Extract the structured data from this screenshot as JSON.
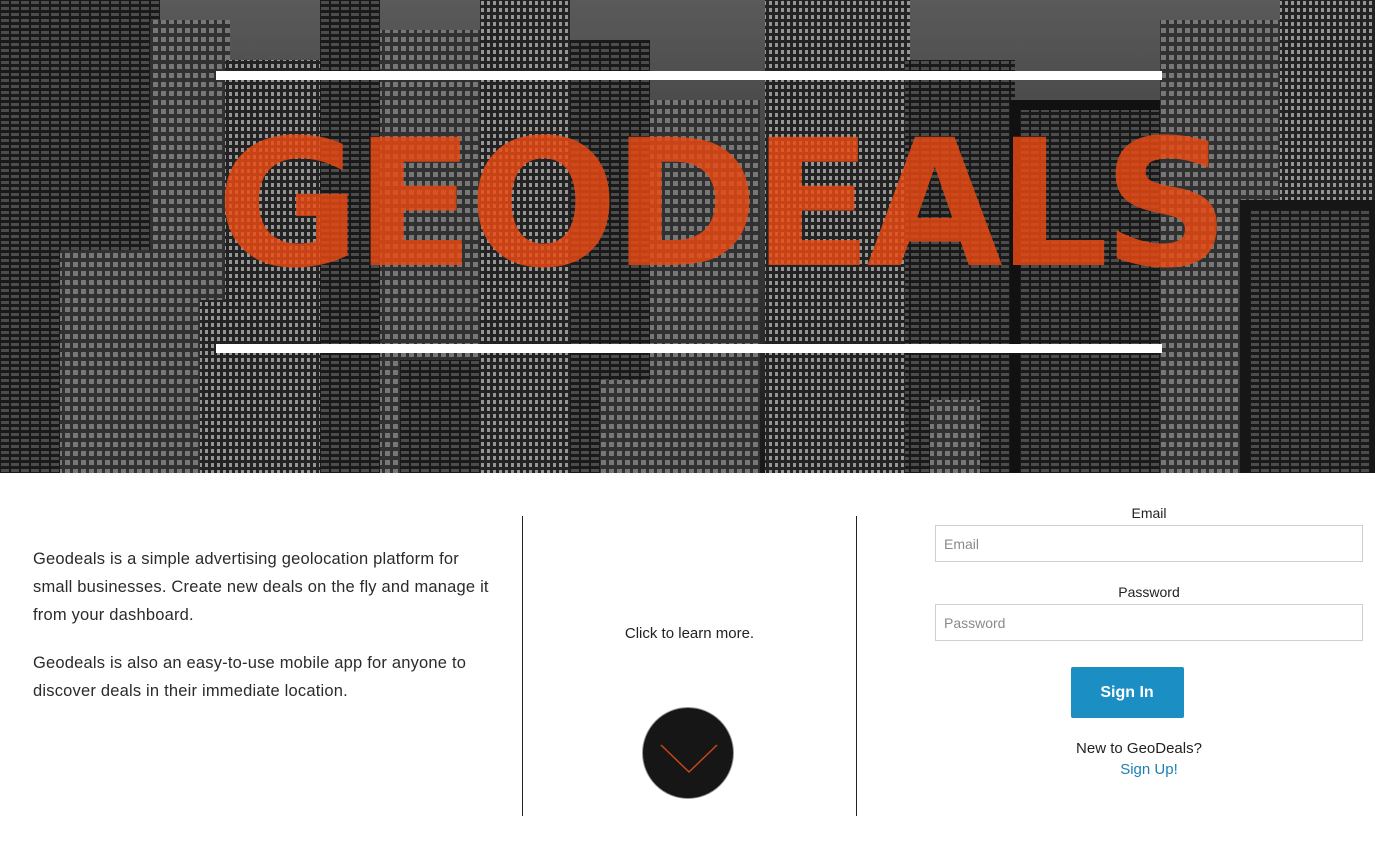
{
  "hero": {
    "title": "GEODEALS"
  },
  "about": {
    "paragraph_1": "Geodeals is a simple advertising geolocation platform for small businesses. Create new deals on the fly and manage it from your dashboard.",
    "paragraph_2": "Geodeals is also an easy-to-use mobile app for anyone to discover deals in their immediate location."
  },
  "learn": {
    "text": "Click to learn more.",
    "icon": "chevron-down-icon"
  },
  "login": {
    "email_label": "Email",
    "email_placeholder": "Email",
    "email_value": "",
    "password_label": "Password",
    "password_placeholder": "Password",
    "password_value": "",
    "signin_label": "Sign In",
    "new_text": "New to GeoDeals?",
    "signup_label": "Sign Up!"
  },
  "colors": {
    "title_orange": "#eb4b14",
    "button_blue": "#1b8fc4",
    "link_blue": "#1b7fb4",
    "circle_dark": "#161616"
  }
}
